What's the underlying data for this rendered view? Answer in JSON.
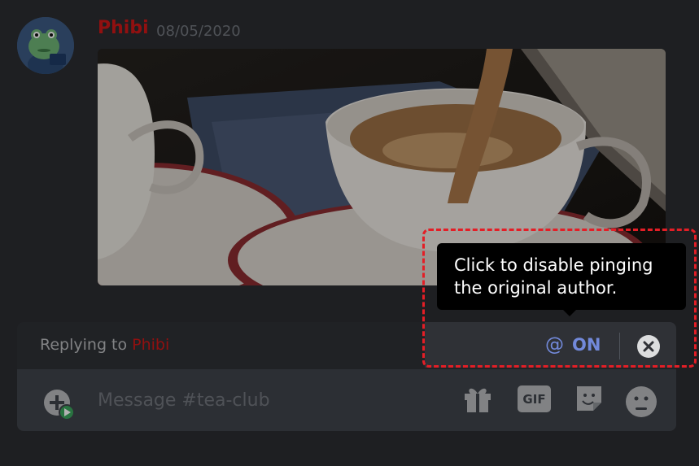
{
  "message": {
    "author": "Phibi",
    "timestamp": "08/05/2020",
    "author_color": "#d01818"
  },
  "reply_bar": {
    "prefix": "Replying to ",
    "author": "Phibi",
    "mention_label": "ON",
    "mention_icon": "at-icon",
    "close_icon": "close-icon"
  },
  "tooltip": {
    "text": "Click to disable pinging the original author."
  },
  "composer": {
    "placeholder": "Message #tea-club",
    "add_icon": "add-attachment-icon",
    "gift_icon": "gift-icon",
    "gif_label": "GIF",
    "sticker_icon": "sticker-icon",
    "emoji_icon": "emoji-icon"
  },
  "colors": {
    "accent": "#7289da",
    "highlight_border": "#e41e26",
    "background": "#2b2d31"
  }
}
